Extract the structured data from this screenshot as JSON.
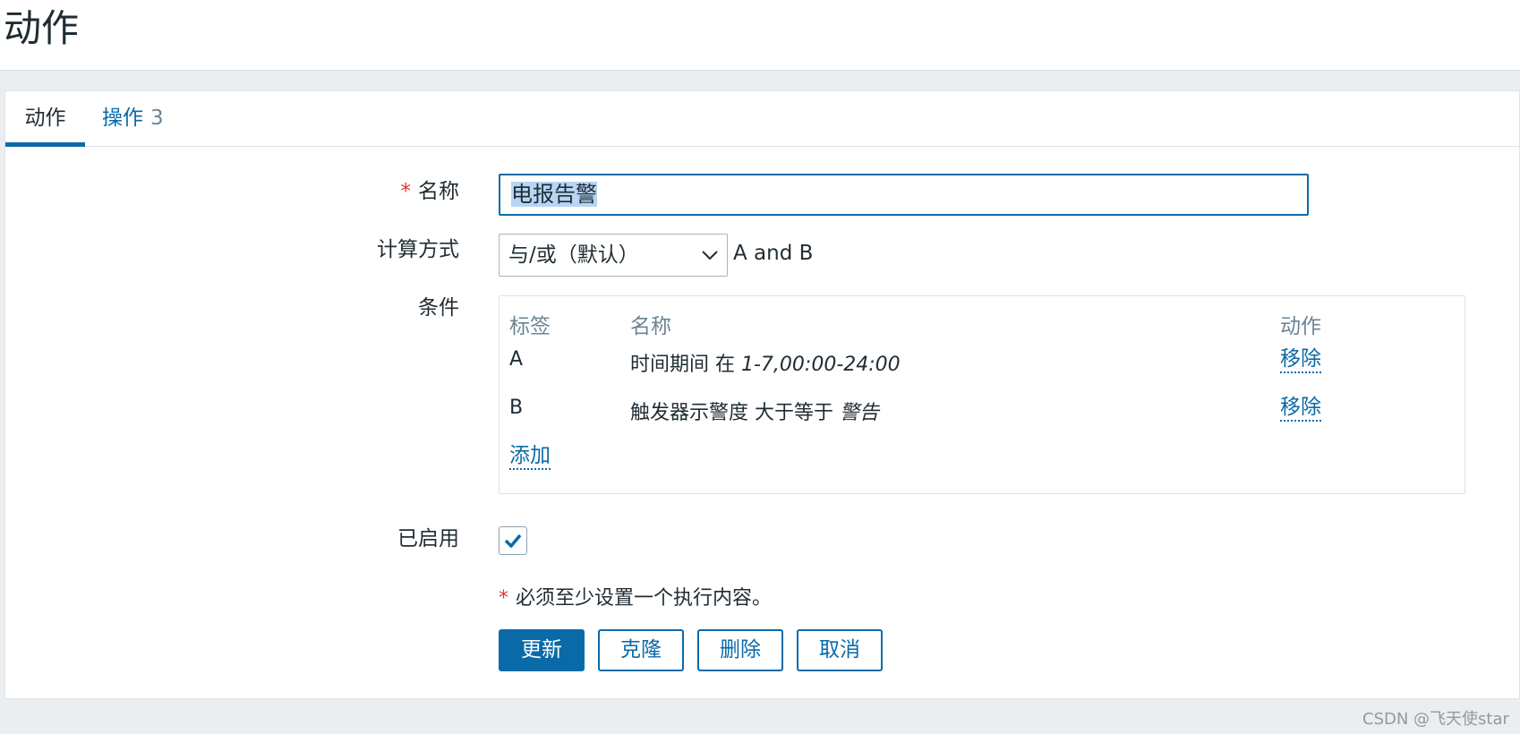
{
  "page": {
    "title": "动作"
  },
  "tabs": [
    {
      "label": "动作"
    },
    {
      "label": "操作",
      "count": "3"
    }
  ],
  "form": {
    "name_label": "名称",
    "name_required_mark": "*",
    "name_value": "电报告警",
    "calc_label": "计算方式",
    "calc_value": "与/或（默认）",
    "calc_formula": "A and B",
    "conditions_label": "条件",
    "conditions": {
      "headers": {
        "label": "标签",
        "name": "名称",
        "action": "动作"
      },
      "rows": [
        {
          "label": "A",
          "text": "时间期间 在",
          "value": "1-7,00:00-24:00",
          "action": "移除"
        },
        {
          "label": "B",
          "text": "触发器示警度 大于等于",
          "value": "警告",
          "action": "移除"
        }
      ],
      "add_label": "添加"
    },
    "enabled_label": "已启用",
    "enabled": true,
    "note_mark": "*",
    "note_text": "必须至少设置一个执行内容。"
  },
  "buttons": {
    "update": "更新",
    "clone": "克隆",
    "delete": "删除",
    "cancel": "取消"
  },
  "colors": {
    "accent": "#0a6aa8",
    "required": "#e53935",
    "page_bg": "#ebeef0"
  },
  "watermark": "CSDN @飞天使star"
}
